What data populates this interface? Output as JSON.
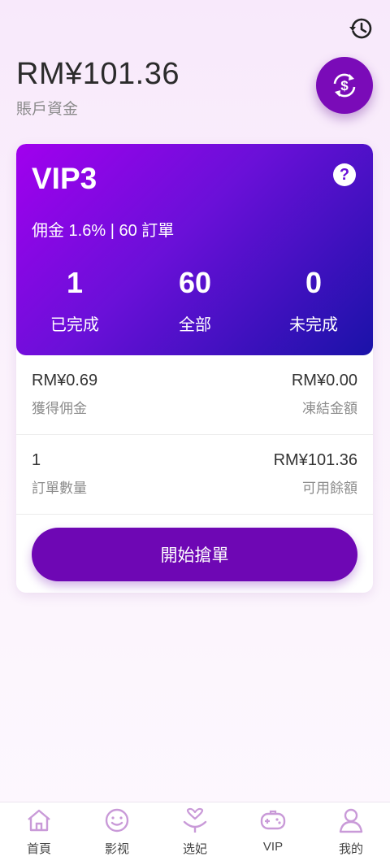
{
  "header": {
    "balance": "RM¥101.36",
    "balance_label": "賬戶資金"
  },
  "vip": {
    "level": "VIP3",
    "commission_line": "佣金 1.6% | 60 訂單",
    "stats": [
      {
        "value": "1",
        "label": "已完成"
      },
      {
        "value": "60",
        "label": "全部"
      },
      {
        "value": "0",
        "label": "未完成"
      }
    ]
  },
  "info": {
    "earned_value": "RM¥0.69",
    "earned_label": "獲得佣金",
    "frozen_value": "RM¥0.00",
    "frozen_label": "凍結金額",
    "orders_value": "1",
    "orders_label": "訂單數量",
    "available_value": "RM¥101.36",
    "available_label": "可用餘額"
  },
  "action": {
    "grab_label": "開始搶單"
  },
  "tabs": [
    {
      "label": "首頁",
      "icon": "home-icon"
    },
    {
      "label": "影视",
      "icon": "smile-icon"
    },
    {
      "label": "选妃",
      "icon": "heart-person-icon"
    },
    {
      "label": "VIP",
      "icon": "gamepad-icon"
    },
    {
      "label": "我的",
      "icon": "user-icon"
    }
  ],
  "colors": {
    "accent": "#6e07b4",
    "tab_icon": "#c99ad8",
    "gradient_start": "#a100ee",
    "gradient_end": "#1a12a8"
  }
}
